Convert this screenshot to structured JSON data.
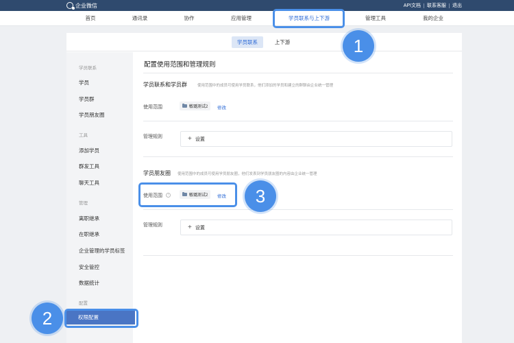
{
  "topbar": {
    "logo_text": "企业微信",
    "links": [
      "API文档",
      "联系客服",
      "退出"
    ]
  },
  "nav": {
    "items": [
      "首页",
      "通讯录",
      "协作",
      "应用管理",
      "学员联系与上下游",
      "管理工具",
      "我的企业"
    ],
    "active_index": 4
  },
  "subtabs": {
    "active": "学员联系",
    "other": "上下游"
  },
  "sidebar": {
    "groups": [
      {
        "title": "学员联系",
        "items": [
          "学员",
          "学员群",
          "学员朋友圈"
        ]
      },
      {
        "title": "工具",
        "items": [
          "添加学员",
          "群发工具",
          "聊天工具"
        ]
      },
      {
        "title": "管理",
        "items": [
          "离职继承",
          "在职继承",
          "企业管理的学员标签",
          "安全管控",
          "数据统计"
        ]
      },
      {
        "title": "配置",
        "items": [
          "权限配置"
        ]
      }
    ],
    "active_item": "权限配置"
  },
  "content": {
    "page_title": "配置使用范围和管理规则",
    "section1": {
      "title": "学员联系和学员群",
      "desc": "使用范围中的成员可使用学员联系，他们添加的学员和建立的群聊由企业统一管理",
      "scope_label": "使用范围",
      "scope_chip": "敏璐测试2",
      "edit_link": "修改",
      "rule_label": "管理规则",
      "rule_button": "设置"
    },
    "section2": {
      "title": "学员朋友圈",
      "desc": "使用范围中的成员可使用学员朋友圈，他们发表到学员朋友圈的内容由企业统一管理",
      "scope_label": "使用范围",
      "info_symbol": "i",
      "scope_chip": "敏璐测试2",
      "edit_link": "修改",
      "rule_label": "管理规则",
      "rule_button": "设置"
    }
  },
  "annotations": {
    "badge1": "1",
    "badge2": "2",
    "badge3": "3",
    "color": "#4a8fe8"
  }
}
